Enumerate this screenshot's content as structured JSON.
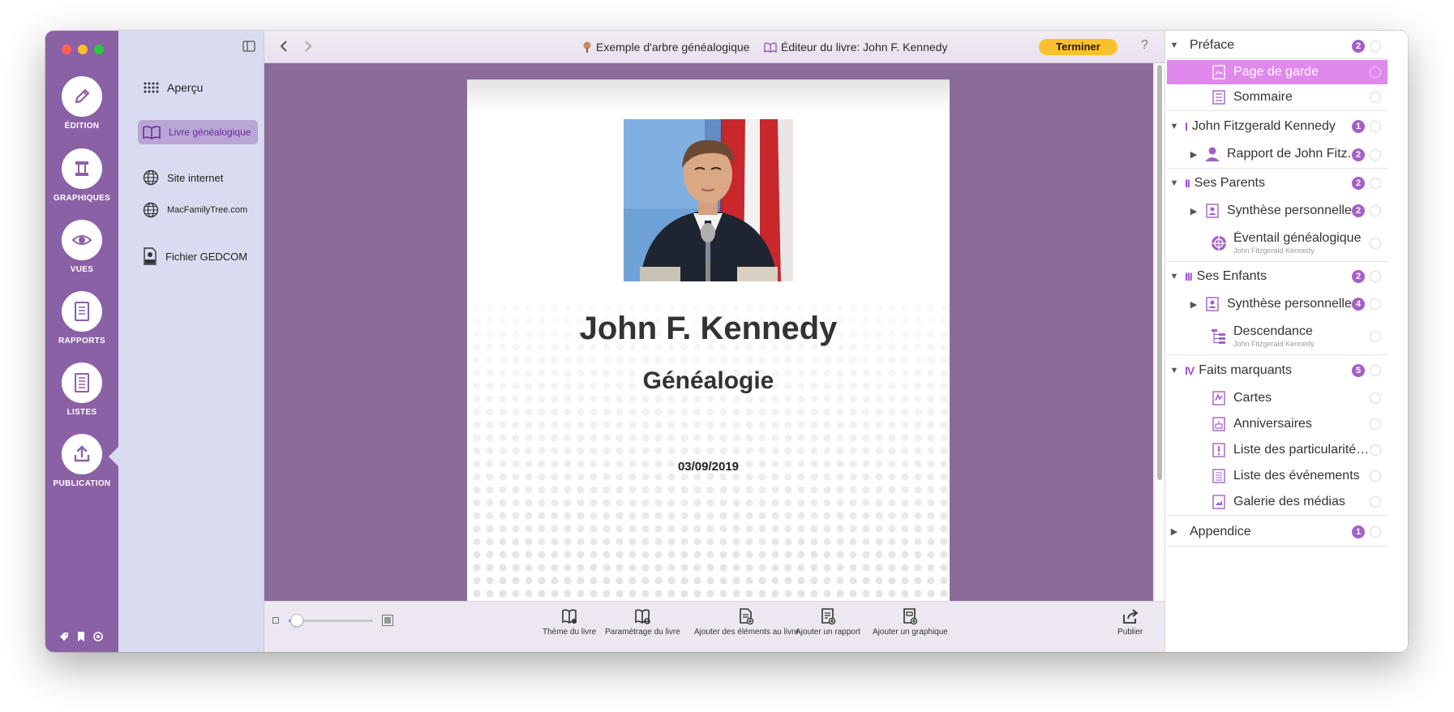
{
  "rail": {
    "items": [
      {
        "label": "ÉDITION",
        "icon": "pencil-icon"
      },
      {
        "label": "GRAPHIQUES",
        "icon": "chart-icon"
      },
      {
        "label": "VUES",
        "icon": "eye-icon"
      },
      {
        "label": "RAPPORTS",
        "icon": "report-icon"
      },
      {
        "label": "LISTES",
        "icon": "list-icon"
      },
      {
        "label": "PUBLICATION",
        "icon": "publish-icon"
      }
    ]
  },
  "nav": {
    "items": [
      {
        "label": "Aperçu",
        "icon": "grid-icon"
      },
      {
        "label": "Livre généalogique",
        "icon": "book-icon"
      },
      {
        "label": "Site internet",
        "icon": "globe-icon"
      },
      {
        "label": "MacFamilyTree.com",
        "icon": "globe-icon"
      },
      {
        "label": "Fichier GEDCOM",
        "icon": "ged-file-icon"
      }
    ]
  },
  "toolbar": {
    "tree_title": "Exemple d'arbre généalogique",
    "editor_title": "Éditeur du livre: John F. Kennedy",
    "finish_label": "Terminer",
    "help_label": "?"
  },
  "page": {
    "name": "John F. Kennedy",
    "subtitle": "Généalogie",
    "date": "03/09/2019"
  },
  "bottombar": {
    "zoom_level": 0.1,
    "buttons": [
      {
        "label": "Thème du livre",
        "icon": "book-theme-icon"
      },
      {
        "label": "Paramétrage du livre",
        "icon": "book-settings-icon"
      },
      {
        "label": "Ajouter des éléments au livre",
        "icon": "add-elements-icon"
      },
      {
        "label": "Ajouter un rapport",
        "icon": "add-report-icon"
      },
      {
        "label": "Ajouter un graphique",
        "icon": "add-chart-icon"
      }
    ],
    "publish_label": "Publier"
  },
  "outline": {
    "preface": {
      "label": "Préface",
      "count": "2"
    },
    "page_de_garde": {
      "label": "Page de garde"
    },
    "sommaire": {
      "label": "Sommaire"
    },
    "jfk_section": {
      "roman": "I",
      "label": "John Fitzgerald Kennedy",
      "count": "1"
    },
    "rapport": {
      "label": "Rapport de John Fitz...",
      "count": "2"
    },
    "parents_section": {
      "roman": "II",
      "label": "Ses Parents",
      "count": "2"
    },
    "synthese1": {
      "label": "Synthèse personnelle",
      "count": "2"
    },
    "eventail": {
      "label": "Éventail généalogique",
      "sub": "John Fitzgerald Kennedy"
    },
    "enfants_section": {
      "roman": "III",
      "label": "Ses Enfants",
      "count": "2"
    },
    "synthese2": {
      "label": "Synthèse personnelle",
      "count": "4"
    },
    "descendance": {
      "label": "Descendance",
      "sub": "John Fitzgerald Kennedy"
    },
    "faits_section": {
      "roman": "IV",
      "label": "Faits marquants",
      "count": "5"
    },
    "cartes": {
      "label": "Cartes"
    },
    "anniversaires": {
      "label": "Anniversaires"
    },
    "particularites": {
      "label": "Liste des particularités..."
    },
    "evenements": {
      "label": "Liste des événements"
    },
    "galerie": {
      "label": "Galerie des médias"
    },
    "appendice": {
      "label": "Appendice",
      "count": "1"
    }
  },
  "colors": {
    "rail_bg": "#8b61a6",
    "nav_bg": "#d9dcf1",
    "canvas_bg": "#8a6b99",
    "accent": "#a460c6",
    "selected_row": "#e188ee",
    "finish_button": "#fbc02d"
  }
}
